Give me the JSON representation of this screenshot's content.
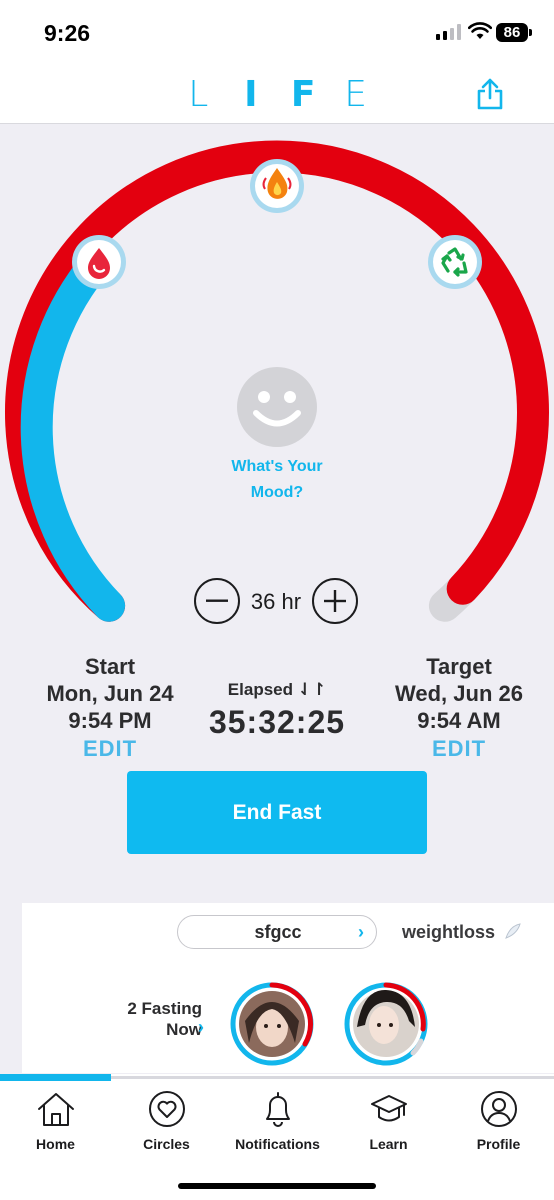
{
  "status": {
    "time": "9:26",
    "battery": "86"
  },
  "header": {
    "logo_letters": [
      "L",
      "I",
      "F",
      "E"
    ],
    "share_icon": "share-icon"
  },
  "dial": {
    "progress_fraction": 0.98,
    "colors": {
      "elapsed": "#12b6ec",
      "remaining": "#e3000f",
      "track": "#d6d6da"
    },
    "milestones": [
      {
        "icon": "drop-icon",
        "name": "drop"
      },
      {
        "icon": "flame-icon",
        "name": "flame"
      },
      {
        "icon": "recycle-icon",
        "name": "recycle"
      }
    ]
  },
  "mood": {
    "line1": "What's Your",
    "line2": "Mood?"
  },
  "duration": {
    "hours": "36 hr"
  },
  "start": {
    "label": "Start",
    "date": "Mon, Jun 24",
    "time": "9:54 PM",
    "edit": "EDIT"
  },
  "elapsed": {
    "label": "Elapsed ⇃↾",
    "value": "35:32:25"
  },
  "target": {
    "label": "Target",
    "date": "Wed, Jun 26",
    "time": "9:54 AM",
    "edit": "EDIT"
  },
  "end_button": "End Fast",
  "circles": {
    "selected": "sfgcc",
    "next_tag": "weightloss",
    "fasting_now_line1": "2 Fasting",
    "fasting_now_line2": "Now"
  },
  "tabs": [
    {
      "label": "Home",
      "icon": "home-icon"
    },
    {
      "label": "Circles",
      "icon": "heart-circle-icon"
    },
    {
      "label": "Notifications",
      "icon": "bell-icon"
    },
    {
      "label": "Learn",
      "icon": "graduation-cap-icon"
    },
    {
      "label": "Profile",
      "icon": "person-icon"
    }
  ]
}
